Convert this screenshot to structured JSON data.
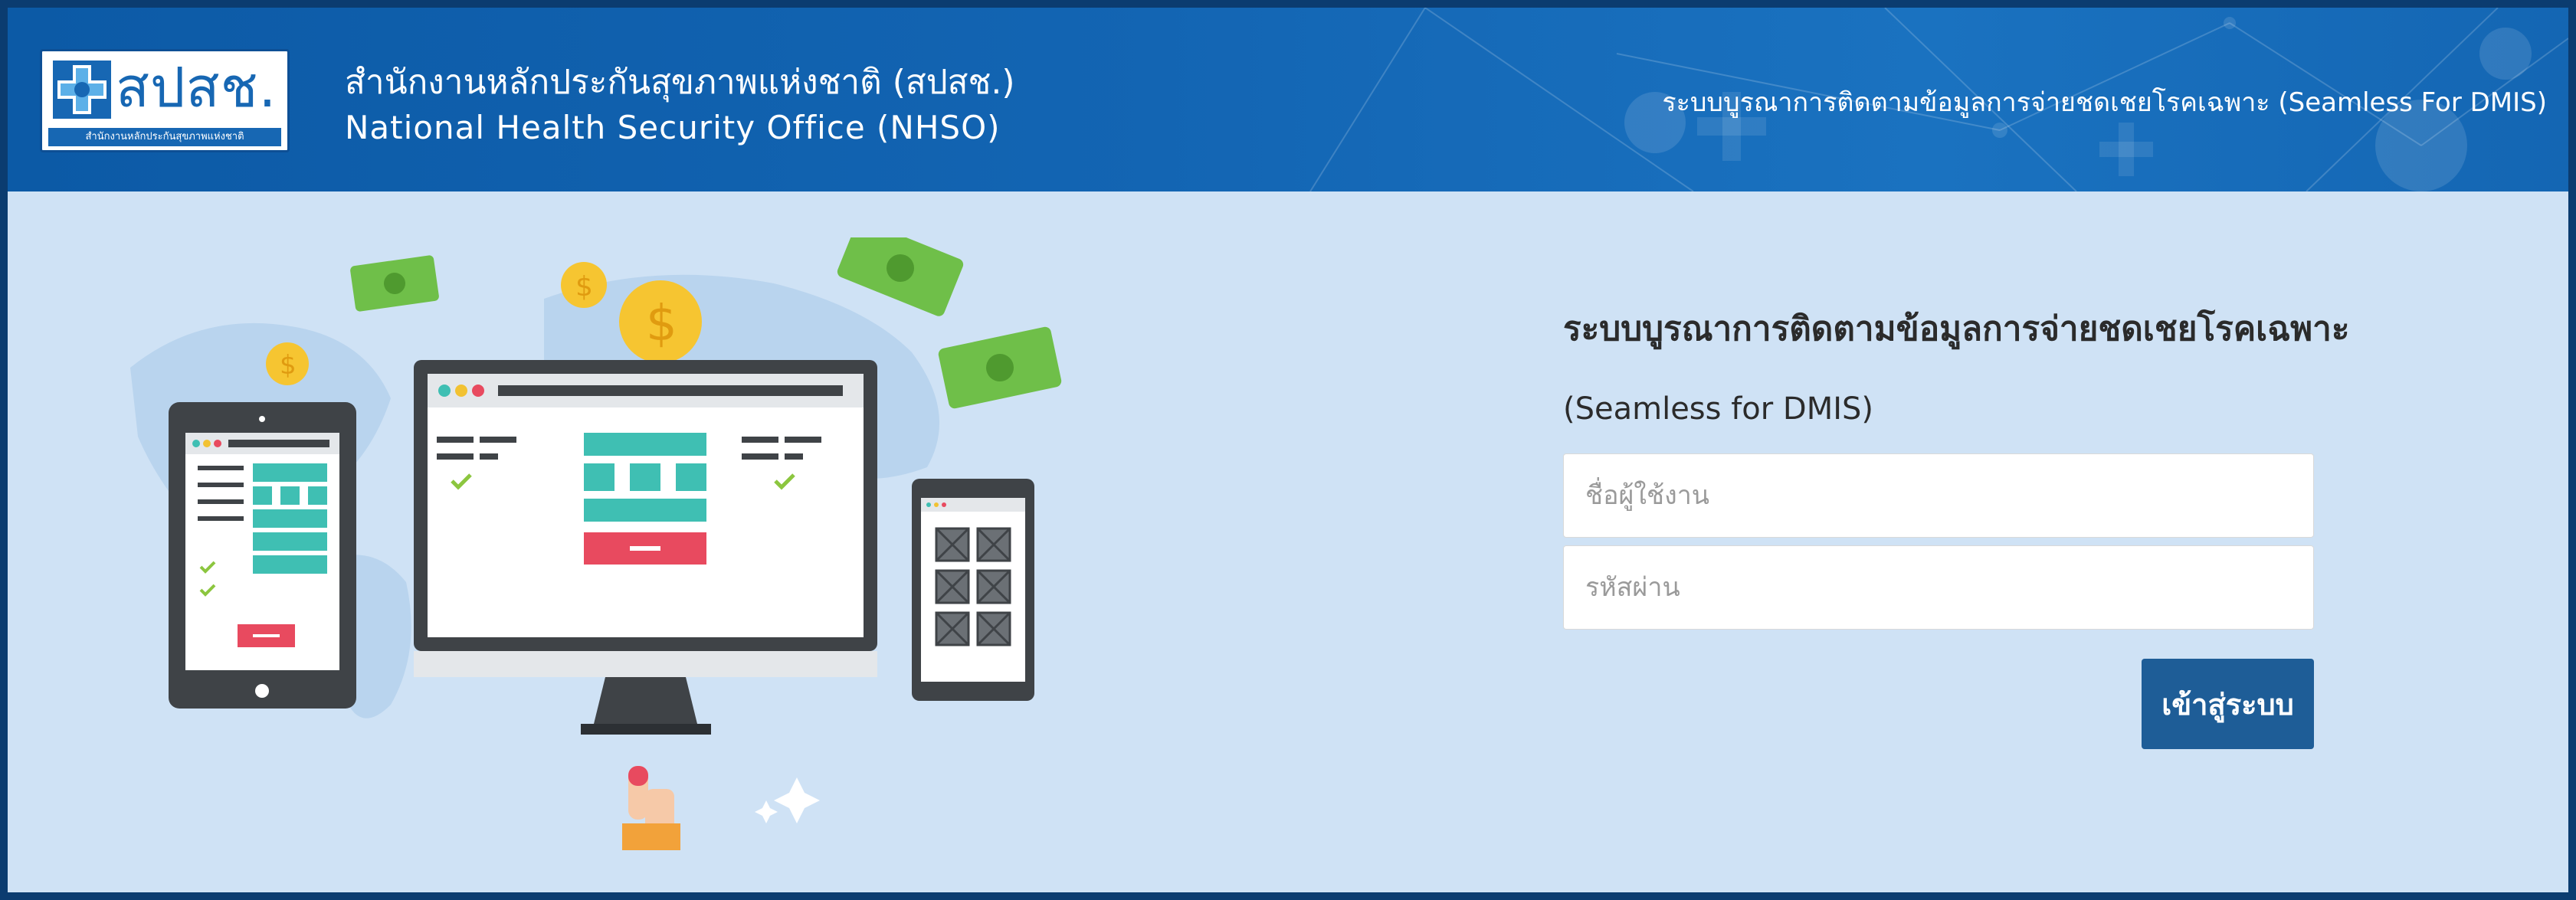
{
  "header": {
    "logo": {
      "mark": "สปสช.",
      "subtext": "สำนักงานหลักประกันสุขภาพแห่งชาติ",
      "icon": "nhso-cross-logo-icon"
    },
    "org_name_th": "สำนักงานหลักประกันสุขภาพแห่งชาติ (สปสช.)",
    "org_name_en": "National Health Security Office (NHSO)",
    "system_title": "ระบบบูรณาการติดตามข้อมูลการจ่ายชดเชยโรคเฉพาะ (Seamless For DMIS)"
  },
  "illustration": {
    "icons": [
      "dollar-coin-icon",
      "banknote-icon",
      "monitor-icon",
      "tablet-icon",
      "phone-icon",
      "hand-click-icon",
      "sparkle-icon"
    ]
  },
  "login": {
    "title": "ระบบบูรณาการติดตามข้อมูลการจ่ายชดเชยโรคเฉพาะ",
    "subtitle": "(Seamless for DMIS)",
    "username_placeholder": "ชื่อผู้ใช้งาน",
    "password_placeholder": "รหัสผ่าน",
    "submit_label": "เข้าสู่ระบบ"
  },
  "colors": {
    "frame": "#0b3c70",
    "header": "#1365b3",
    "page_background": "#cfe2f5",
    "button": "#1e5d97"
  }
}
